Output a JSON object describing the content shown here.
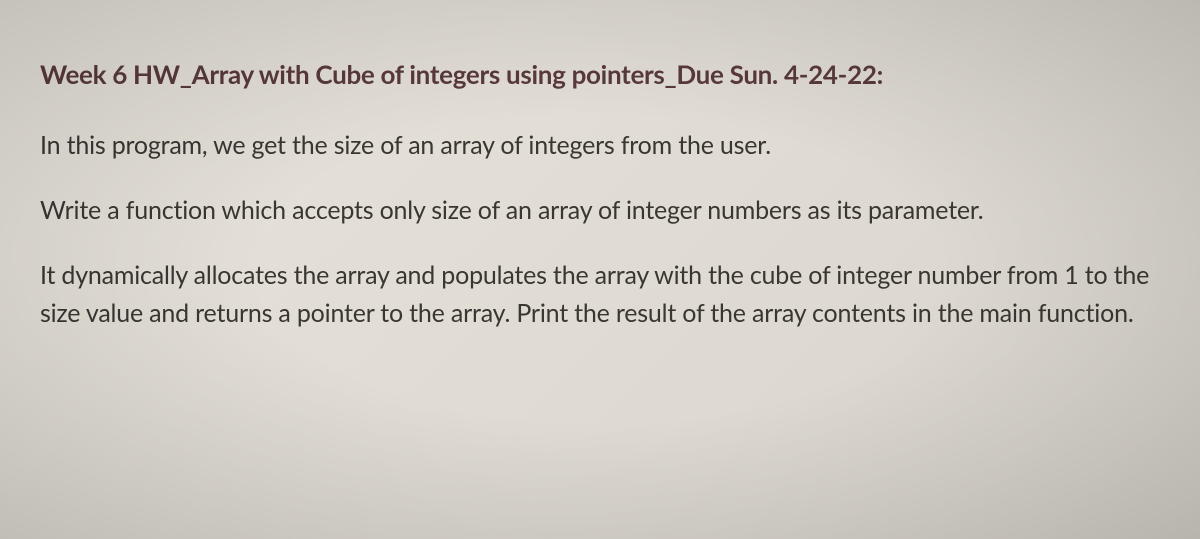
{
  "document": {
    "heading": "Week 6 HW_Array with Cube of integers using pointers_Due Sun. 4-24-22:",
    "paragraphs": [
      "In this program, we get the size of an array of integers from the user.",
      "Write a function which accepts only size of an array of integer numbers as its parameter.",
      "It dynamically allocates the array and populates the array with the cube of integer number from 1 to the size value and returns a pointer to the array. Print the result of the array contents in the main function."
    ]
  }
}
